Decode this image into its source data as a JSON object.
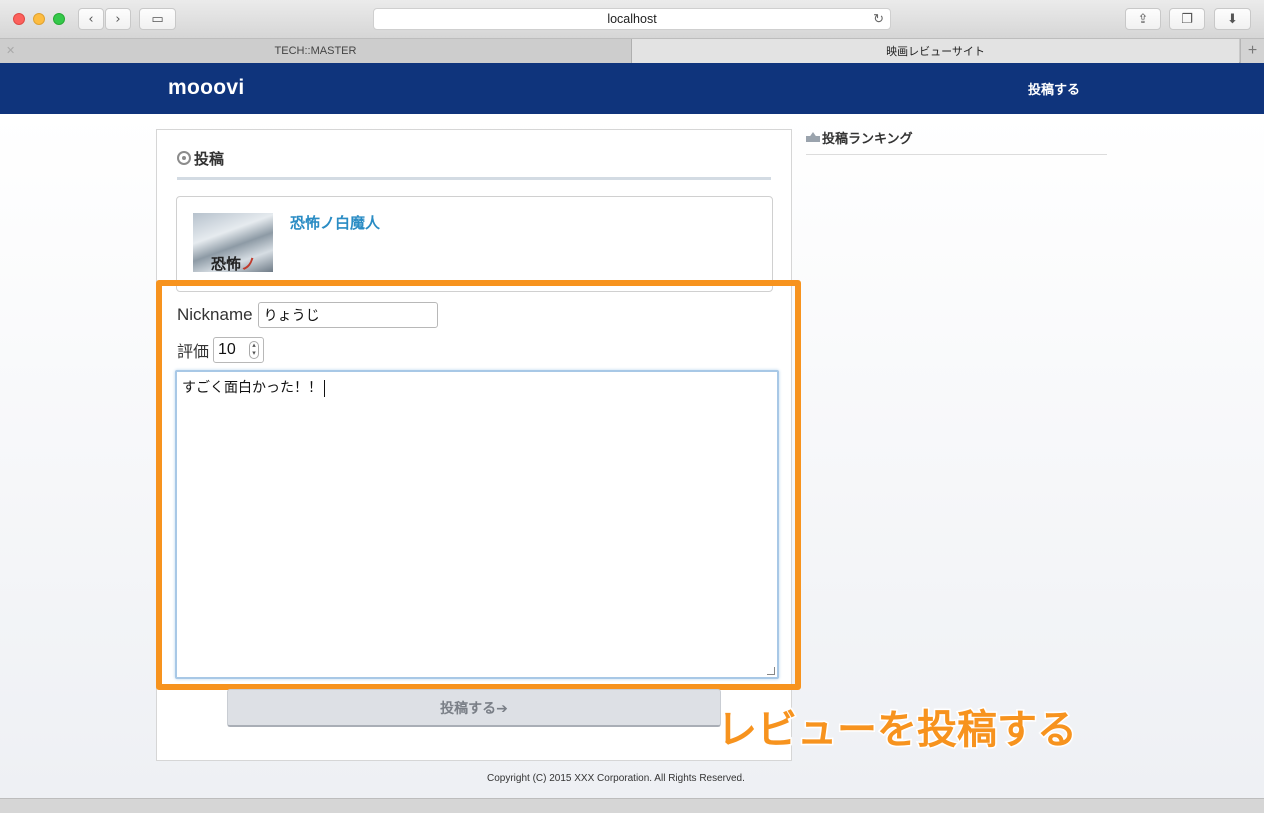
{
  "browser": {
    "url": "localhost",
    "tabs": [
      {
        "label": "TECH::MASTER"
      },
      {
        "label": "映画レビューサイト"
      }
    ]
  },
  "header": {
    "logo": "mooovi",
    "post_link": "投稿する"
  },
  "main": {
    "section_title": "投稿",
    "movie": {
      "title": "恐怖ノ白魔人",
      "poster_text": "恐怖",
      "poster_text_accent": "ノ"
    },
    "form": {
      "nickname_label": "Nickname",
      "nickname_value": "りょうじ",
      "rating_label": "評価",
      "rating_value": "10",
      "review_text": "すごく面白かった！！",
      "submit_label": "投稿する➔"
    }
  },
  "sidebar": {
    "ranking_title": "投稿ランキング"
  },
  "annotation": "レビューを投稿する",
  "footer": {
    "copyright": "Copyright (C) 2015 XXX Corporation. All Rights Reserved."
  },
  "colors": {
    "header_bg": "#0f347c",
    "highlight": "#f7931e",
    "movie_title": "#2a8cc4"
  },
  "icons": [
    "film-reel-icon",
    "crown-icon",
    "back-icon",
    "forward-icon",
    "sidebar-icon",
    "reload-icon",
    "share-icon",
    "tabs-icon",
    "download-icon",
    "new-tab-icon"
  ]
}
